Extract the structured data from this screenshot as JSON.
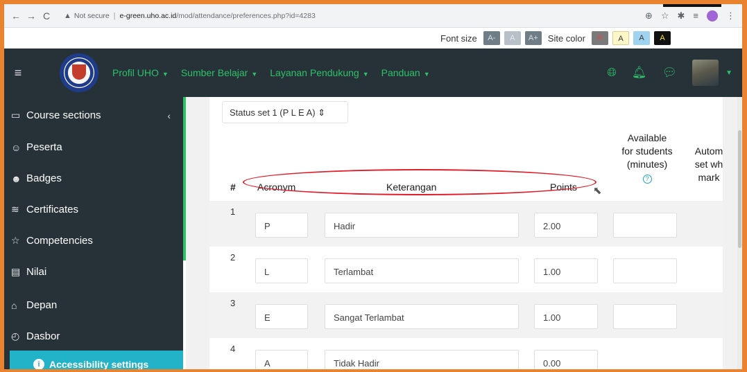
{
  "browser": {
    "security_label": "Not secure",
    "url_host": "e-green.uho.ac.id",
    "url_path": "/mod/attendance/preferences.php?id=4283"
  },
  "a11y_toolbar": {
    "font_size_label": "Font size",
    "font_buttons": [
      "A-",
      "A",
      "A+"
    ],
    "site_color_label": "Site color",
    "color_buttons": [
      "R",
      "A",
      "A",
      "A"
    ]
  },
  "navbar": {
    "menu": [
      {
        "label": "Profil UHO"
      },
      {
        "label": "Sumber Belajar"
      },
      {
        "label": "Layanan Pendukung"
      },
      {
        "label": "Panduan"
      }
    ]
  },
  "sidebar": {
    "items": [
      {
        "label": "Course sections",
        "icon": "folder-icon"
      },
      {
        "label": "Peserta",
        "icon": "users-icon"
      },
      {
        "label": "Badges",
        "icon": "badge-icon"
      },
      {
        "label": "Certificates",
        "icon": "certificate-icon"
      },
      {
        "label": "Competencies",
        "icon": "star-icon"
      },
      {
        "label": "Nilai",
        "icon": "gradebook-icon"
      },
      {
        "label": "Depan",
        "icon": "home-icon"
      },
      {
        "label": "Dasbor",
        "icon": "dashboard-icon"
      }
    ],
    "accessibility_settings": "Accessibility settings"
  },
  "main": {
    "status_set": "Status set 1 (P L E A)",
    "headers": {
      "hash": "#",
      "acronym": "Acronym",
      "keterangan": "Keterangan",
      "points": "Points",
      "available": [
        "Available",
        "for students",
        "(minutes)"
      ],
      "automark": [
        "Autom",
        "set wh",
        "mark"
      ]
    },
    "rows": [
      {
        "num": "1",
        "acronym": "P",
        "keterangan": "Hadir",
        "points": "2.00",
        "available": ""
      },
      {
        "num": "2",
        "acronym": "L",
        "keterangan": "Terlambat",
        "points": "1.00",
        "available": ""
      },
      {
        "num": "3",
        "acronym": "E",
        "keterangan": "Sangat Terlambat",
        "points": "1.00",
        "available": ""
      },
      {
        "num": "4",
        "acronym": "A",
        "keterangan": "Tidak Hadir",
        "points": "0.00",
        "available": ""
      }
    ]
  },
  "colors": {
    "frame_border": "#e9832f",
    "navbar_bg": "#263238",
    "accent_green": "#2ec16a",
    "annotation_red": "#e01d2a",
    "accessibility_teal": "#22b3c9"
  }
}
